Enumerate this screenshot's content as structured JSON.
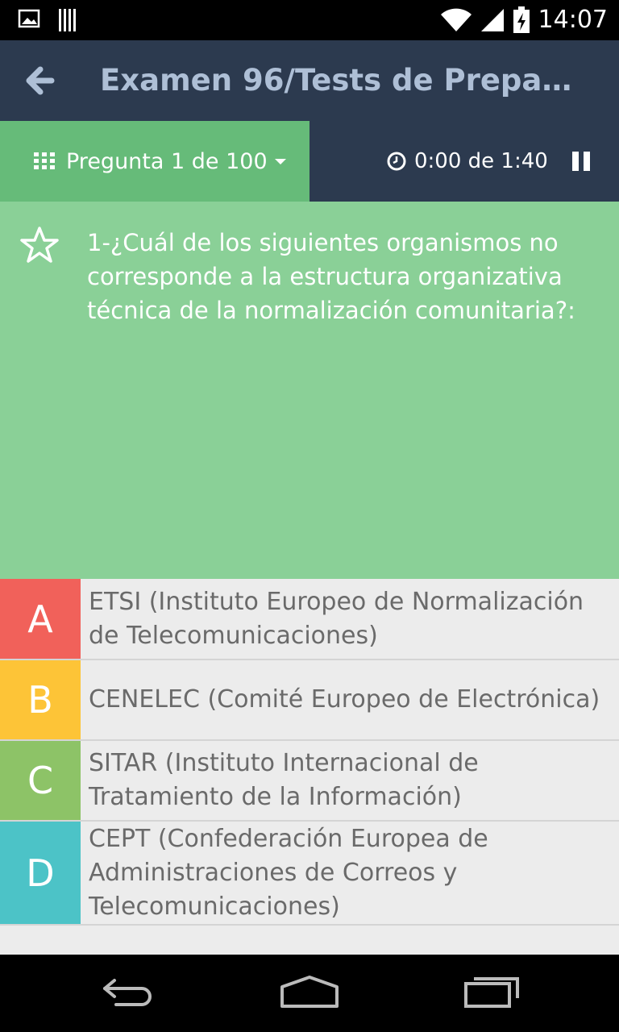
{
  "status_bar": {
    "time": "14:07",
    "icons": [
      "image-notification-icon",
      "barcode-notification-icon",
      "wifi-icon",
      "signal-icon",
      "battery-charging-icon"
    ]
  },
  "app_bar": {
    "title": "Examen 96/Tests de Prepa…"
  },
  "sub_bar": {
    "question_nav_label": "Pregunta 1 de 100",
    "timer_label": "0:00 de 1:40"
  },
  "question": {
    "text": "1-¿Cuál de los siguientes organismos no corresponde a la estructura organizativa técnica de la normalización comunitaria?:"
  },
  "answers": [
    {
      "letter": "A",
      "text": "ETSI (Instituto Europeo de Normalización de Telecomunicaciones)",
      "color": "#f1615a"
    },
    {
      "letter": "B",
      "text": "CENELEC (Comité Europeo de Electrónica)",
      "color": "#fdc437"
    },
    {
      "letter": "C",
      "text": "SITAR (Instituto Internacional de Tratamiento de la Información)",
      "color": "#8dc367"
    },
    {
      "letter": "D",
      "text": "CEPT (Confederación Europea de Administraciones de Correos y Telecomunicaciones)",
      "color": "#4cc3c7"
    }
  ],
  "colors": {
    "app_bar": "#2c3a4f",
    "title_text": "#aebfd6",
    "question_nav": "#66bb79",
    "question_area": "#8ad097",
    "answer_bg": "#ececec"
  }
}
